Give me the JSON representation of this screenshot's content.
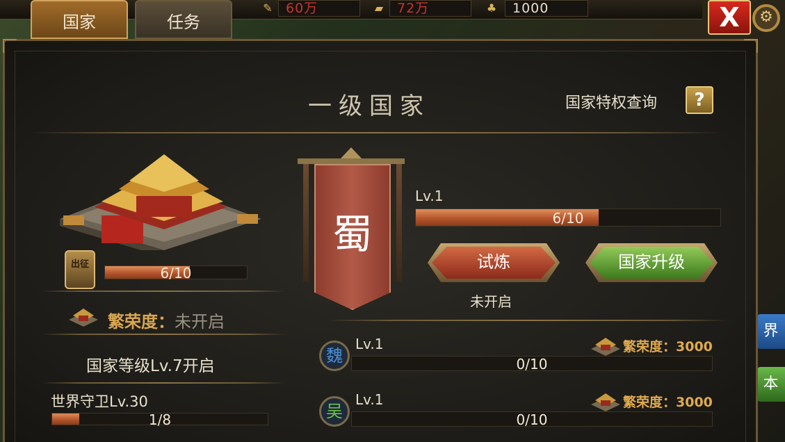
{
  "tabs": {
    "country": "国家",
    "mission": "任务"
  },
  "resources": [
    {
      "icon": "scroll-icon",
      "value": "60万",
      "color": "#c8352a"
    },
    {
      "icon": "gold-ingot-icon",
      "value": "72万",
      "color": "#c8352a"
    },
    {
      "icon": "food-sack-icon",
      "value": "1000",
      "color": "#e8e0cc"
    }
  ],
  "close_label": "X",
  "side_buttons": {
    "world": "界",
    "original": "本"
  },
  "panel": {
    "title": "一级国家",
    "privilege_query": "国家特权查询",
    "help_label": "?",
    "chuzheng_label": "出征",
    "palace_progress": {
      "text": "6/10",
      "fraction": 0.6
    },
    "prosperity_label": "繁荣度：",
    "prosperity_status": "未开启",
    "unlock_text": "国家等级Lv.7开启",
    "world_guard": {
      "label": "世界守卫Lv.30",
      "text": "1/8",
      "fraction": 0.125
    },
    "banner_char": "蜀",
    "main_level": {
      "label": "Lv.1",
      "text": "6/10",
      "fraction": 0.6
    },
    "trial_button": "试炼",
    "upgrade_button": "国家升级",
    "trial_status": "未开启",
    "kingdoms": [
      {
        "icon_char": "魏",
        "icon_color": "#4a90d9",
        "level": "Lv.1",
        "progress_text": "0/10",
        "fraction": 0,
        "prosperity": "繁荣度：3000"
      },
      {
        "icon_char": "吴",
        "icon_color": "#6bc24a",
        "level": "Lv.1",
        "progress_text": "0/10",
        "fraction": 0,
        "prosperity": "繁荣度：3000"
      }
    ]
  },
  "colors": {
    "accent_gold": "#d9a651",
    "bar_fill": "#b1522a",
    "banner_red": "#b25a48"
  }
}
